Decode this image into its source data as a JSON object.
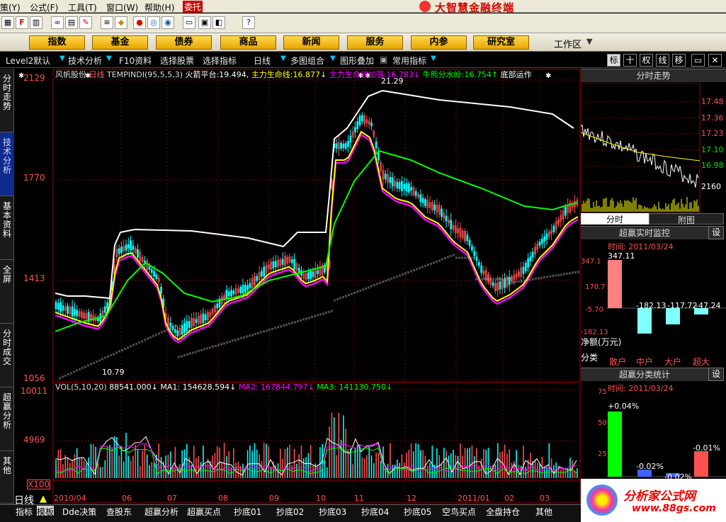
{
  "menu": {
    "items": [
      "策(Y)",
      "公式(F)",
      "工具(T)",
      "窗口(W)",
      "帮助(H)"
    ],
    "trade_button": "委托",
    "app_title": "大智慧金融终端"
  },
  "navbar": {
    "buttons": [
      "指数",
      "基金",
      "债券",
      "商品",
      "新闻",
      "服务",
      "内参",
      "研究室"
    ],
    "workarea": "工作区"
  },
  "subbar": {
    "items": [
      "Level2默认",
      "技术分析",
      "F10资料",
      "选择股票",
      "选择指标",
      "日线",
      "多图组合",
      "图形叠加",
      "常用指标"
    ],
    "right_tabs": [
      "标",
      "十",
      "权",
      "线",
      "移"
    ]
  },
  "sidetabs": [
    "分时走势",
    "技术分析",
    "基本资料",
    "全屏",
    "分时成交",
    "超赢分析",
    "其他"
  ],
  "chart_header": {
    "stock": "风帆股份",
    "period": "日线",
    "indicator": "TEMPINDI(95,5,5,3)",
    "values": [
      {
        "label": "火箭平台:",
        "value": "19.494,",
        "color": "#ffffff"
      },
      {
        "label": "主力生命线:",
        "value": "16.877↓",
        "color": "#ffff00"
      },
      {
        "label": "主力生命线加强:",
        "value": "16.783↓",
        "color": "#ff00ff"
      },
      {
        "label": "牛熊分水岭:",
        "value": "16.754↑",
        "color": "#00ff00"
      },
      {
        "label": "底部运作",
        "value": "",
        "color": "#ffffff"
      }
    ]
  },
  "vol_header": {
    "label": "VOL(5,10,20)",
    "vol": "88541.000↓",
    "ma1": "MA1: 154628.594↓",
    "ma2": "MA2: 167844.797↓",
    "ma3": "MA3: 141130.750↓"
  },
  "price_axis": [
    "2129",
    "1770",
    "1413",
    "1056"
  ],
  "vol_axis": [
    "10011",
    "4969",
    "X100"
  ],
  "annotations": {
    "high": "21.29",
    "low": "10.79"
  },
  "date_axis": [
    "2010/04",
    "06",
    "07",
    "08",
    "09",
    "10",
    "11",
    "12",
    "2011/01",
    "02",
    "03"
  ],
  "intraday": {
    "title": "分时走势",
    "prices": [
      "17.48",
      "17.36",
      "17.23",
      "17.10",
      "16.98"
    ],
    "vol_label": "2160",
    "tabs": [
      "分时",
      "附图"
    ]
  },
  "monitor": {
    "title": "超赢实时监控",
    "set": "设",
    "time": "时间: 2011/03/24",
    "axis": [
      "347.1",
      "170.7",
      "-5.70",
      "-182.13"
    ],
    "values": [
      "347.11",
      "-182.13",
      "-117.72",
      "-47.24"
    ],
    "net_label": "净额(万元)",
    "class_label": "分类",
    "cats": [
      "散户",
      "中户",
      "大户",
      "超大"
    ]
  },
  "classify": {
    "title": "超赢分类统计",
    "set": "设",
    "time": "时间: 2011/03/24",
    "axis": [
      "75",
      "50",
      "25"
    ],
    "values": [
      "+0.04%",
      "-0.02%",
      "-0.02%",
      "-0.01%"
    ]
  },
  "bottom": {
    "period": "日线",
    "tabs": [
      "指标",
      "模板",
      "Dde决策",
      "查股东",
      "超赢分析",
      "超赢买点",
      "抄底01",
      "抄底02",
      "抄底03",
      "抄底04",
      "抄底05",
      "空鸟买点",
      "全盘持仓",
      "其他"
    ]
  },
  "logo": {
    "text": "分析家公式网",
    "url": "www.88gs.com"
  },
  "colors": {
    "up": "#ff5050",
    "down": "#00ffff",
    "yellow": "#ffff00",
    "magenta": "#ff00ff",
    "green": "#00ff00"
  }
}
